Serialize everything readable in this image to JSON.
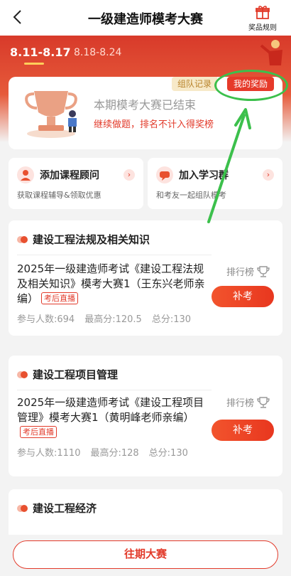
{
  "header": {
    "title": "一级建造师模考大赛",
    "rules_label": "奖品规则"
  },
  "tabs": [
    {
      "label": "8.11-8.17",
      "active": true
    },
    {
      "label": "8.18-8.24",
      "active": false
    }
  ],
  "status": {
    "team_record": "组队记录",
    "my_reward": "我的奖励",
    "ended": "本期模考大赛已结束",
    "continue": "继续做题，排名不计入得奖榜"
  },
  "actions": [
    {
      "title": "添加课程顾问",
      "subtitle": "获取课程辅导&领取优惠",
      "icon": "advisor-icon"
    },
    {
      "title": "加入学习群",
      "subtitle": "和考友一起组队模考",
      "icon": "group-chat-icon"
    }
  ],
  "subjects": [
    {
      "name": "建设工程法规及相关知识",
      "exam_title": "2025年一级建造师考试《建设工程法规及相关知识》模考大赛1（王东兴老师亲编）",
      "tag": "考后直播",
      "rank_label": "排行榜",
      "button": "补考",
      "participants": "参与人数:694",
      "high_score": "最高分:120.5",
      "total": "总分:130"
    },
    {
      "name": "建设工程项目管理",
      "exam_title": "2025年一级建造师考试《建设工程项目管理》模考大赛1（黄明峰老师亲编）",
      "tag": "考后直播",
      "rank_label": "排行榜",
      "button": "补考",
      "participants": "参与人数:1110",
      "high_score": "最高分:128",
      "total": "总分:130"
    },
    {
      "name": "建设工程经济"
    }
  ],
  "bottom": {
    "history_button": "往期大赛"
  },
  "colors": {
    "primary_red": "#e23a2a",
    "annotation_green": "#3cc04c"
  }
}
